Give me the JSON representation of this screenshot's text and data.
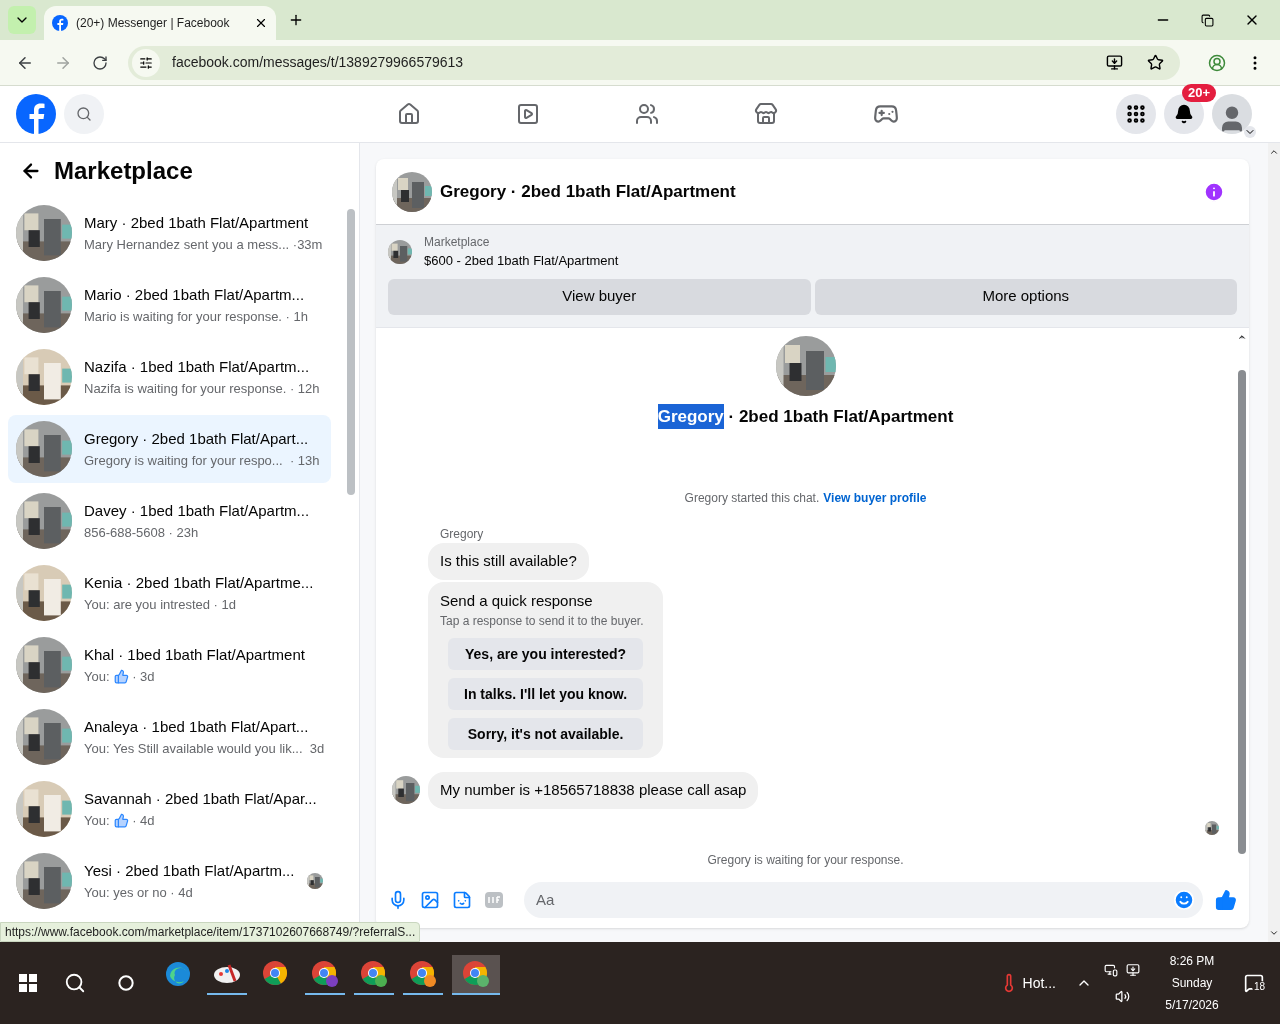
{
  "browser": {
    "tab_title": "(20+) Messenger | Facebook",
    "url": "facebook.com/messages/t/1389279966579613"
  },
  "nav": {
    "notification_badge": "20+"
  },
  "sidebar": {
    "title": "Marketplace",
    "conversations": [
      {
        "name": "Mary · 2bed 1bath Flat/Apartment",
        "kind": "text",
        "preview": "Mary Hernandez sent you a mess...",
        "time": " ·33m",
        "selected": false,
        "seen_avatar": false
      },
      {
        "name": "Mario · 2bed 1bath Flat/Apartm...",
        "kind": "text",
        "preview": "Mario is waiting for your response.",
        "time": " · 1h",
        "selected": false,
        "seen_avatar": false
      },
      {
        "name": "Nazifa · 1bed 1bath Flat/Apartm...",
        "kind": "text",
        "preview": "Nazifa is waiting for your response.",
        "time": " · 12h",
        "selected": false,
        "seen_avatar": false
      },
      {
        "name": "Gregory · 2bed 1bath Flat/Apart...",
        "kind": "text",
        "preview": "Gregory is waiting for your respo...",
        "time": "  · 13h",
        "selected": true,
        "seen_avatar": false
      },
      {
        "name": "Davey · 1bed 1bath Flat/Apartm...",
        "kind": "text",
        "preview": "856-688-5608",
        "time": " · 23h",
        "selected": false,
        "seen_avatar": false
      },
      {
        "name": "Kenia · 2bed 1bath Flat/Apartme...",
        "kind": "text",
        "preview": "You: are you intrested",
        "time": " · 1d",
        "selected": false,
        "seen_avatar": false
      },
      {
        "name": "Khal · 1bed 1bath Flat/Apartment",
        "kind": "like",
        "preview": "You:",
        "time": " · 3d",
        "selected": false,
        "seen_avatar": false
      },
      {
        "name": "Analeya · 1bed 1bath Flat/Apart...",
        "kind": "text",
        "preview": "You: Yes Still available would you lik...",
        "time": "  3d",
        "selected": false,
        "seen_avatar": false
      },
      {
        "name": "Savannah · 2bed 1bath Flat/Apar...",
        "kind": "like",
        "preview": "You:",
        "time": " · 4d",
        "selected": false,
        "seen_avatar": false
      },
      {
        "name": "Yesi · 2bed 1bath Flat/Apartm...",
        "kind": "text",
        "preview": "You: yes or no",
        "time": " · 4d",
        "selected": false,
        "seen_avatar": true
      }
    ]
  },
  "chat": {
    "title": "Gregory · 2bed 1bath Flat/Apartment",
    "listing": {
      "source": "Marketplace",
      "title": "$600 - 2bed 1bath Flat/Apartment",
      "buttons": [
        "View buyer",
        "More options"
      ]
    },
    "intro": {
      "name": "Gregory",
      "name_highlighted": true,
      "rest": " · 2bed 1bath Flat/Apartment",
      "started": "Gregory started this chat.",
      "link": "View buyer profile"
    },
    "messages": [
      {
        "kind": "incoming",
        "sender": "Gregory",
        "text": "Is this still available?"
      },
      {
        "kind": "quick_response",
        "title": "Send a quick response",
        "subtitle": "Tap a response to send it to the buyer.",
        "options": [
          "Yes, are you interested?",
          "In talks. I'll let you know.",
          "Sorry, it's not available."
        ]
      },
      {
        "kind": "incoming_avatar",
        "text": "My number is +18565718838 please call asap"
      }
    ],
    "status": "Gregory is waiting for your response.",
    "composer": {
      "placeholder": "Aa"
    }
  },
  "status_url": "https://www.facebook.com/marketplace/item/1737102607668749/?referralS...",
  "taskbar": {
    "apps": [
      {
        "kind": "edge",
        "running": false,
        "active": false
      },
      {
        "kind": "drawing",
        "running": true,
        "active": false
      },
      {
        "kind": "chrome",
        "running": false,
        "active": false
      },
      {
        "kind": "chrome",
        "color": "#7b3fbf",
        "running": true,
        "active": false
      },
      {
        "kind": "chrome",
        "color": "#4caf50",
        "running": true,
        "active": false
      },
      {
        "kind": "chrome",
        "color": "#f08a24",
        "running": true,
        "active": false
      },
      {
        "kind": "chrome",
        "color": "#5bb36b",
        "running": true,
        "active": true
      }
    ],
    "weather": "Hot...",
    "time": "8:26 PM",
    "day": "Sunday",
    "date": "5/17/2026",
    "notifications": "18"
  }
}
